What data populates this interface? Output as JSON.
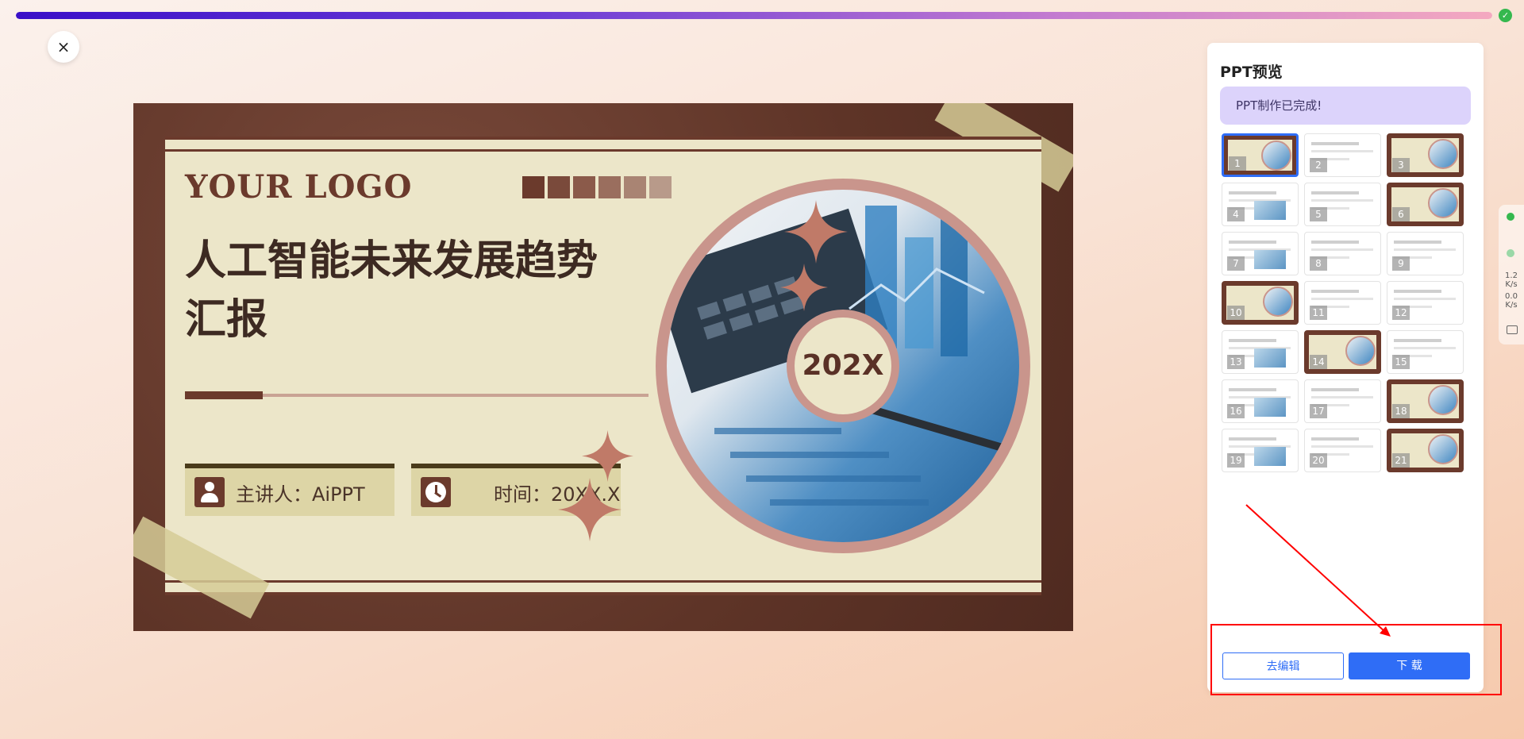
{
  "progress": {
    "value_percent": 100,
    "status": "complete"
  },
  "close_label": "×",
  "slide": {
    "logo": "YOUR LOGO",
    "title_line1": "人工智能未来发展趋势",
    "title_line2": "汇报",
    "presenter": "主讲人：AiPPT",
    "time": "时间：20XX.X",
    "year": "202X",
    "swatch_colors": [
      "#6b3a2c",
      "#7a4a3b",
      "#8b5a4a",
      "#9a6e5e",
      "#a98473",
      "#b89a8a"
    ]
  },
  "panel": {
    "title": "PPT预览",
    "notice": "PPT制作已完成!",
    "thumbnails": [
      {
        "num": "1",
        "style": "brown",
        "selected": true
      },
      {
        "num": "2",
        "style": "white"
      },
      {
        "num": "3",
        "style": "brown"
      },
      {
        "num": "4",
        "style": "white"
      },
      {
        "num": "5",
        "style": "white"
      },
      {
        "num": "6",
        "style": "brown"
      },
      {
        "num": "7",
        "style": "white"
      },
      {
        "num": "8",
        "style": "white"
      },
      {
        "num": "9",
        "style": "white"
      },
      {
        "num": "10",
        "style": "brown"
      },
      {
        "num": "11",
        "style": "white"
      },
      {
        "num": "12",
        "style": "white"
      },
      {
        "num": "13",
        "style": "white"
      },
      {
        "num": "14",
        "style": "brown"
      },
      {
        "num": "15",
        "style": "white"
      },
      {
        "num": "16",
        "style": "white"
      },
      {
        "num": "17",
        "style": "white"
      },
      {
        "num": "18",
        "style": "brown"
      },
      {
        "num": "19",
        "style": "white"
      },
      {
        "num": "20",
        "style": "white"
      },
      {
        "num": "21",
        "style": "brown"
      }
    ],
    "edit_label": "去编辑",
    "download_label": "下 载"
  },
  "side_widget": {
    "upload_speed": "1.2",
    "upload_unit": "K/s",
    "download_speed": "0.0",
    "download_unit": "K/s"
  },
  "colors": {
    "accent": "#2f6df6",
    "highlight": "#ff0000",
    "success": "#35b84e"
  }
}
